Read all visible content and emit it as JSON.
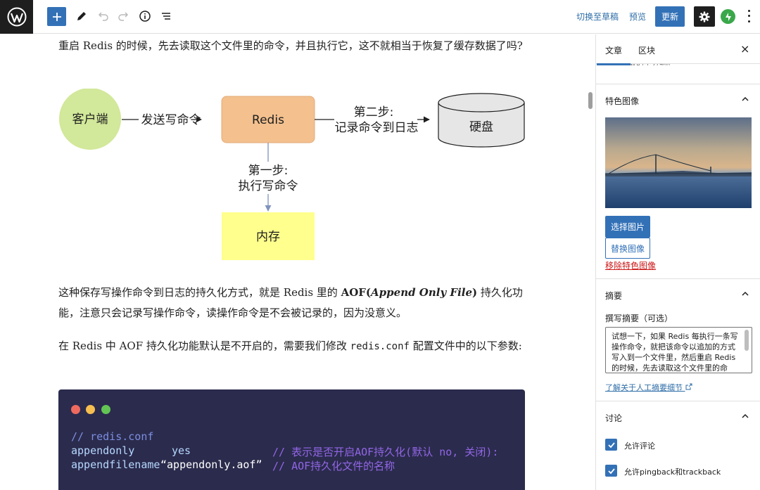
{
  "toolbar": {
    "switch_draft": "切换至草稿",
    "preview": "预览",
    "update": "更新"
  },
  "content": {
    "para1": "重启 Redis 的时候，先去读取这个文件里的命令，并且执行它，这不就相当于恢复了缓存数据了吗?",
    "para2_a": "这种保存写操作命令到日志的持久化方式，就是 Redis 里的 ",
    "para2_bold": "AOF(",
    "para2_bold_italic": "Append Only File",
    "para2_bold_close": ")",
    "para2_b": " 持久化功能，注意只会记录写操作命令，读操作命令是不会被记录的，因为没意义。",
    "para3_a": "在 Redis 中 AOF 持久化功能默认是不开启的，需要我们修改 ",
    "para3_code": "redis.conf",
    "para3_b": " 配置文件中的以下参数:"
  },
  "diagram": {
    "client": "客户端",
    "send_cmd": "发送写命令",
    "redis": "Redis",
    "step2_line1": "第二步:",
    "step2_line2": "记录命令到日志",
    "disk": "硬盘",
    "step1_line1": "第一步:",
    "step1_line2": "执行写命令",
    "memory": "内存"
  },
  "code": {
    "comment_file": "// redis.conf",
    "key1": "appendonly",
    "val1": "yes",
    "comment1": "// 表示是否开启AOF持久化(默认 no, 关闭):",
    "key2": "appendfilename",
    "val2": "“appendonly.aof”",
    "comment2": "// AOF持久化文件的名称"
  },
  "sidebar": {
    "tab_post": "文章",
    "tab_block": "区块",
    "close": "×",
    "cut_text": "用途等最的中分辆。",
    "featured_title": "特色图像",
    "select_image": "选择图片",
    "replace_image": "替换图像",
    "remove_image": "移除特色图像",
    "excerpt_title": "摘要",
    "excerpt_label": "撰写摘要（可选）",
    "excerpt_text": "试想一下，如果 Redis 每执行一条写操作命令，就把该命令以追加的方式写入到一个文件里，然后重启 Redis 的时候，先去读取这个文件里的命令，并且执行它",
    "learn_more": "了解关于人工摘要细节",
    "discussion_title": "讨论",
    "allow_comments": "允许评论",
    "allow_pingbacks": "允许pingback和trackback"
  }
}
